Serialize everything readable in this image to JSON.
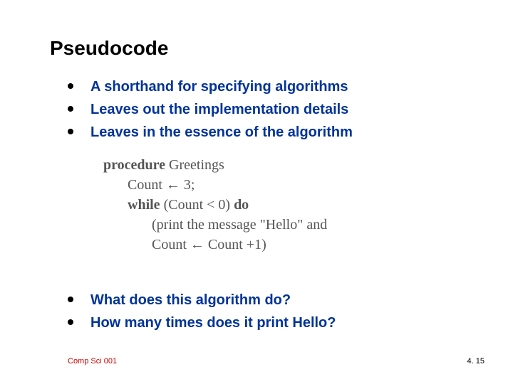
{
  "title": "Pseudocode",
  "bullets_top": [
    "A shorthand for specifying algorithms",
    "Leaves out the implementation details",
    "Leaves in the essence of the algorithm"
  ],
  "pseudocode": {
    "line1_kw": "procedure",
    "line1_rest": " Greetings",
    "line2": "Count ← 3;",
    "line3_kw1": "while",
    "line3_mid": " (Count < 0) ",
    "line3_kw2": "do",
    "line4": "(print the message \"Hello\" and",
    "line5": "Count ← Count +1)"
  },
  "bullets_bottom": [
    "What does this algorithm do?",
    "How many times does it print Hello?"
  ],
  "footer": {
    "left": "Comp Sci 001",
    "right": "4. 15"
  }
}
